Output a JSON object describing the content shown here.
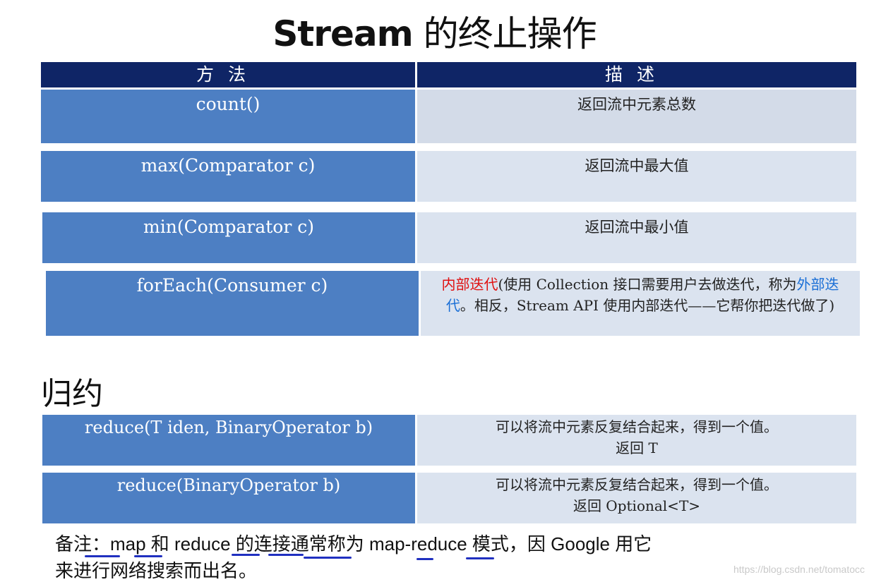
{
  "title": {
    "latin": "Stream",
    "cjk": " 的终止操作"
  },
  "table": {
    "header": {
      "method": "方法",
      "description": "描述"
    },
    "rows": [
      {
        "method": "count()",
        "description": "返回流中元素总数"
      },
      {
        "method": "max(Comparator c)",
        "description": "返回流中最大值"
      },
      {
        "method": "min(Comparator c)",
        "description": "返回流中最小值"
      },
      {
        "method": "forEach(Consumer c)",
        "description_parts": {
          "red": "内部迭代",
          "part1": "(使用 Collection 接口需要用户去做迭代，称为",
          "blue": "外部迭代",
          "part2": "。相反，Stream API 使用内部迭代——它帮你把迭代做了)"
        }
      }
    ]
  },
  "reduce_section": {
    "heading": "归约",
    "rows": [
      {
        "method": "reduce(T iden, BinaryOperator b)",
        "description_line1": "可以将流中元素反复结合起来，得到一个值。",
        "description_line2": "返回 T"
      },
      {
        "method": "reduce(BinaryOperator b)",
        "description_line1": "可以将流中元素反复结合起来，得到一个值。",
        "description_line2": "返回 Optional<T>"
      }
    ]
  },
  "note": {
    "line1": "备注：map 和 reduce 的连接通常称为 map-reduce 模式，因 Google 用它",
    "line2": "来进行网络搜索而出名。"
  },
  "watermark": "https://blog.csdn.net/tomatocc",
  "colors": {
    "header_bg": "#0f2566",
    "method_bg": "#4d7fc3",
    "desc_bg": "#d3dbe8",
    "highlight_red": "#e01010",
    "highlight_blue": "#1a6fd6"
  }
}
